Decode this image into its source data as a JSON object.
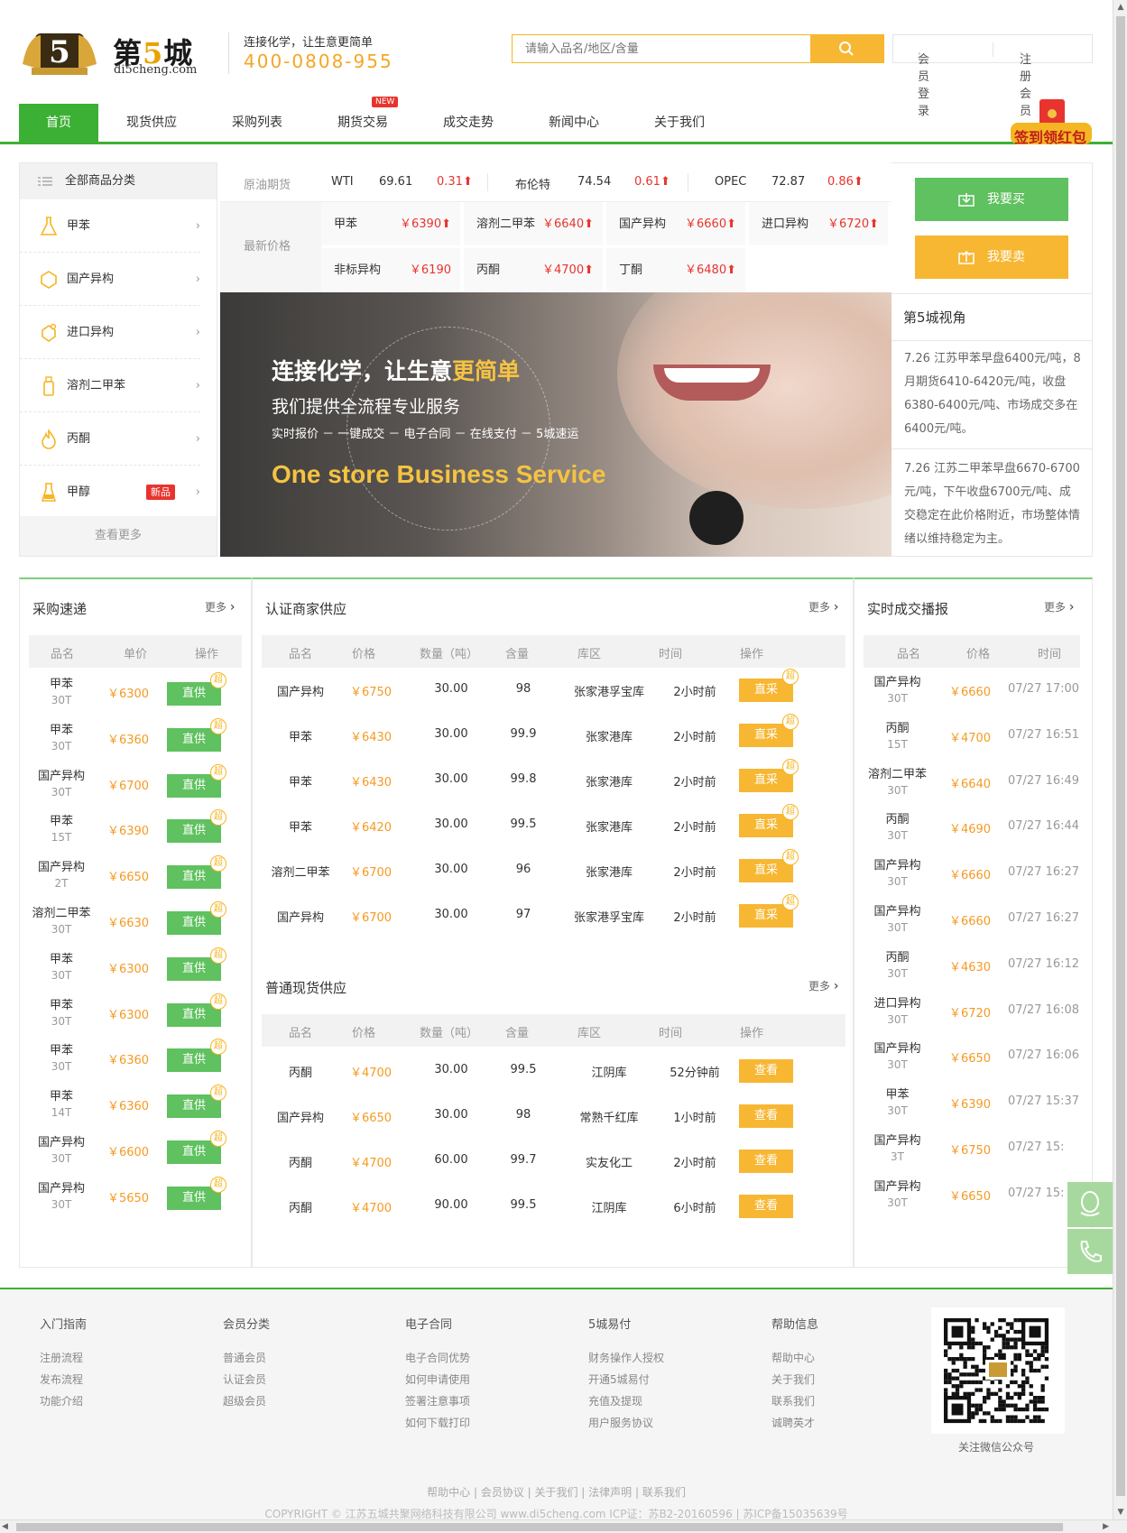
{
  "brand": {
    "name_pre": "第",
    "name_num": "5",
    "name_post": "城",
    "domain": "di5cheng.com",
    "slogan": "连接化学，让生意更简单",
    "phone": "400-0808-955",
    "logo_num": "5"
  },
  "search": {
    "placeholder": "请输入品名/地区/含量"
  },
  "user": {
    "login": "会员登录",
    "register": "注册会员"
  },
  "nav": {
    "items": [
      "首页",
      "现货供应",
      "采购列表",
      "期货交易",
      "成交走势",
      "新闻中心",
      "关于我们"
    ],
    "new_badge": "NEW",
    "redpack": "签到领红包"
  },
  "sidebar": {
    "title": "全部商品分类",
    "items": [
      "甲苯",
      "国产异构",
      "进口异构",
      "溶剂二甲苯",
      "丙酮",
      "甲醇"
    ],
    "new_tag": "新品",
    "more": "查看更多"
  },
  "ticker": {
    "oil_label": "原油期货",
    "oil": [
      {
        "name": "WTI",
        "value": "69.61",
        "change": "0.31"
      },
      {
        "name": "布伦特",
        "value": "74.54",
        "change": "0.61"
      },
      {
        "name": "OPEC",
        "value": "72.87",
        "change": "0.86"
      }
    ],
    "latest_label": "最新价格",
    "prices": [
      {
        "name": "甲苯",
        "price": "￥6390"
      },
      {
        "name": "溶剂二甲苯",
        "price": "￥6640"
      },
      {
        "name": "国产异构",
        "price": "￥6660"
      },
      {
        "name": "进口异构",
        "price": "￥6720"
      },
      {
        "name": "非标异构",
        "price": "￥6190"
      },
      {
        "name": "丙酮",
        "price": "￥4700"
      },
      {
        "name": "丁酮",
        "price": "￥6480"
      }
    ]
  },
  "banner": {
    "title_pre": "连接化学，让生意",
    "title_hl": "更简单",
    "subtitle": "我们提供全流程专业服务",
    "steps": "实时报价 － 一键成交 － 电子合同 － 在线支付 － 5城速运",
    "english": "One store Business Service"
  },
  "actions": {
    "buy": "我要买",
    "sell": "我要卖"
  },
  "view": {
    "title": "第5城视角",
    "news": [
      "7.26 江苏甲苯早盘6400元/吨，8月期货6410-6420元/吨，收盘6380-6400元/吨、市场成交多在6400元/吨。",
      "7.26 江苏二甲苯早盘6670-6700元/吨，下午收盘6700元/吨、成交稳定在此价格附近，市场整体情绪以维持稳定为主。"
    ]
  },
  "purchase": {
    "title": "采购速递",
    "more": "更多",
    "headers": [
      "品名",
      "单价",
      "操作"
    ],
    "btn": "直供",
    "badge": "超",
    "rows": [
      {
        "name": "甲苯",
        "qty": "30T",
        "price": "￥6300"
      },
      {
        "name": "甲苯",
        "qty": "30T",
        "price": "￥6360"
      },
      {
        "name": "国产异构",
        "qty": "30T",
        "price": "￥6700"
      },
      {
        "name": "甲苯",
        "qty": "15T",
        "price": "￥6390"
      },
      {
        "name": "国产异构",
        "qty": "2T",
        "price": "￥6650"
      },
      {
        "name": "溶剂二甲苯",
        "qty": "30T",
        "price": "￥6630"
      },
      {
        "name": "甲苯",
        "qty": "30T",
        "price": "￥6300"
      },
      {
        "name": "甲苯",
        "qty": "30T",
        "price": "￥6300"
      },
      {
        "name": "甲苯",
        "qty": "30T",
        "price": "￥6360"
      },
      {
        "name": "甲苯",
        "qty": "14T",
        "price": "￥6360"
      },
      {
        "name": "国产异构",
        "qty": "30T",
        "price": "￥6600"
      },
      {
        "name": "国产异构",
        "qty": "30T",
        "price": "￥5650"
      }
    ]
  },
  "certified": {
    "title": "认证商家供应",
    "more": "更多",
    "headers": [
      "品名",
      "价格",
      "数量（吨）",
      "含量",
      "库区",
      "时间",
      "操作"
    ],
    "btn": "直采",
    "badge": "超",
    "rows": [
      {
        "name": "国产异构",
        "price": "￥6750",
        "qty": "30.00",
        "purity": "98",
        "depot": "张家港孚宝库",
        "time": "2小时前"
      },
      {
        "name": "甲苯",
        "price": "￥6430",
        "qty": "30.00",
        "purity": "99.9",
        "depot": "张家港库",
        "time": "2小时前"
      },
      {
        "name": "甲苯",
        "price": "￥6430",
        "qty": "30.00",
        "purity": "99.8",
        "depot": "张家港库",
        "time": "2小时前"
      },
      {
        "name": "甲苯",
        "price": "￥6420",
        "qty": "30.00",
        "purity": "99.5",
        "depot": "张家港库",
        "time": "2小时前"
      },
      {
        "name": "溶剂二甲苯",
        "price": "￥6700",
        "qty": "30.00",
        "purity": "96",
        "depot": "张家港库",
        "time": "2小时前"
      },
      {
        "name": "国产异构",
        "price": "￥6700",
        "qty": "30.00",
        "purity": "97",
        "depot": "张家港孚宝库",
        "time": "2小时前"
      }
    ]
  },
  "normal": {
    "title": "普通现货供应",
    "more": "更多",
    "headers": [
      "品名",
      "价格",
      "数量（吨）",
      "含量",
      "库区",
      "时间",
      "操作"
    ],
    "btn": "查看",
    "rows": [
      {
        "name": "丙酮",
        "price": "￥4700",
        "qty": "30.00",
        "purity": "99.5",
        "depot": "江阴库",
        "time": "52分钟前"
      },
      {
        "name": "国产异构",
        "price": "￥6650",
        "qty": "30.00",
        "purity": "98",
        "depot": "常熟千红库",
        "time": "1小时前"
      },
      {
        "name": "丙酮",
        "price": "￥4700",
        "qty": "60.00",
        "purity": "99.7",
        "depot": "实友化工",
        "time": "2小时前"
      },
      {
        "name": "丙酮",
        "price": "￥4700",
        "qty": "90.00",
        "purity": "99.5",
        "depot": "江阴库",
        "time": "6小时前"
      }
    ]
  },
  "deals": {
    "title": "实时成交播报",
    "more": "更多",
    "headers": [
      "品名",
      "价格",
      "时间"
    ],
    "rows": [
      {
        "name": "国产异构",
        "qty": "30T",
        "price": "￥6660",
        "time": "07/27 17:00"
      },
      {
        "name": "丙酮",
        "qty": "15T",
        "price": "￥4700",
        "time": "07/27 16:51"
      },
      {
        "name": "溶剂二甲苯",
        "qty": "30T",
        "price": "￥6640",
        "time": "07/27 16:49"
      },
      {
        "name": "丙酮",
        "qty": "30T",
        "price": "￥4690",
        "time": "07/27 16:44"
      },
      {
        "name": "国产异构",
        "qty": "30T",
        "price": "￥6660",
        "time": "07/27 16:27"
      },
      {
        "name": "国产异构",
        "qty": "30T",
        "price": "￥6660",
        "time": "07/27 16:27"
      },
      {
        "name": "丙酮",
        "qty": "30T",
        "price": "￥4630",
        "time": "07/27 16:12"
      },
      {
        "name": "进口异构",
        "qty": "30T",
        "price": "￥6720",
        "time": "07/27 16:08"
      },
      {
        "name": "国产异构",
        "qty": "30T",
        "price": "￥6650",
        "time": "07/27 16:06"
      },
      {
        "name": "甲苯",
        "qty": "30T",
        "price": "￥6390",
        "time": "07/27 15:37"
      },
      {
        "name": "国产异构",
        "qty": "3T",
        "price": "￥6750",
        "time": "07/27 15:"
      },
      {
        "name": "国产异构",
        "qty": "30T",
        "price": "￥6650",
        "time": "07/27 15:"
      }
    ]
  },
  "footer": {
    "cols": [
      {
        "title": "入门指南",
        "links": [
          "注册流程",
          "发布流程",
          "功能介绍"
        ]
      },
      {
        "title": "会员分类",
        "links": [
          "普通会员",
          "认证会员",
          "超级会员"
        ]
      },
      {
        "title": "电子合同",
        "links": [
          "电子合同优势",
          "如何申请使用",
          "签署注意事项",
          "如何下载打印"
        ]
      },
      {
        "title": "5城易付",
        "links": [
          "财务操作人授权",
          "开通5城易付",
          "充值及提现",
          "用户服务协议"
        ]
      },
      {
        "title": "帮助信息",
        "links": [
          "帮助中心",
          "关于我们",
          "联系我们",
          "诚聘英才"
        ]
      }
    ],
    "qr_caption": "关注微信公众号",
    "links": "帮助中心 | 会员协议 | 关于我们 | 法律声明 | 联系我们",
    "copyright": "COPYRIGHT © 江苏五城共聚网络科技有限公司 www.di5cheng.com ICP证：苏B2-20160596 | 苏ICP备15035639号"
  },
  "colors": {
    "green": "#3cb034",
    "orange": "#f7b733",
    "red": "#e8342e",
    "price": "#f59a23"
  }
}
